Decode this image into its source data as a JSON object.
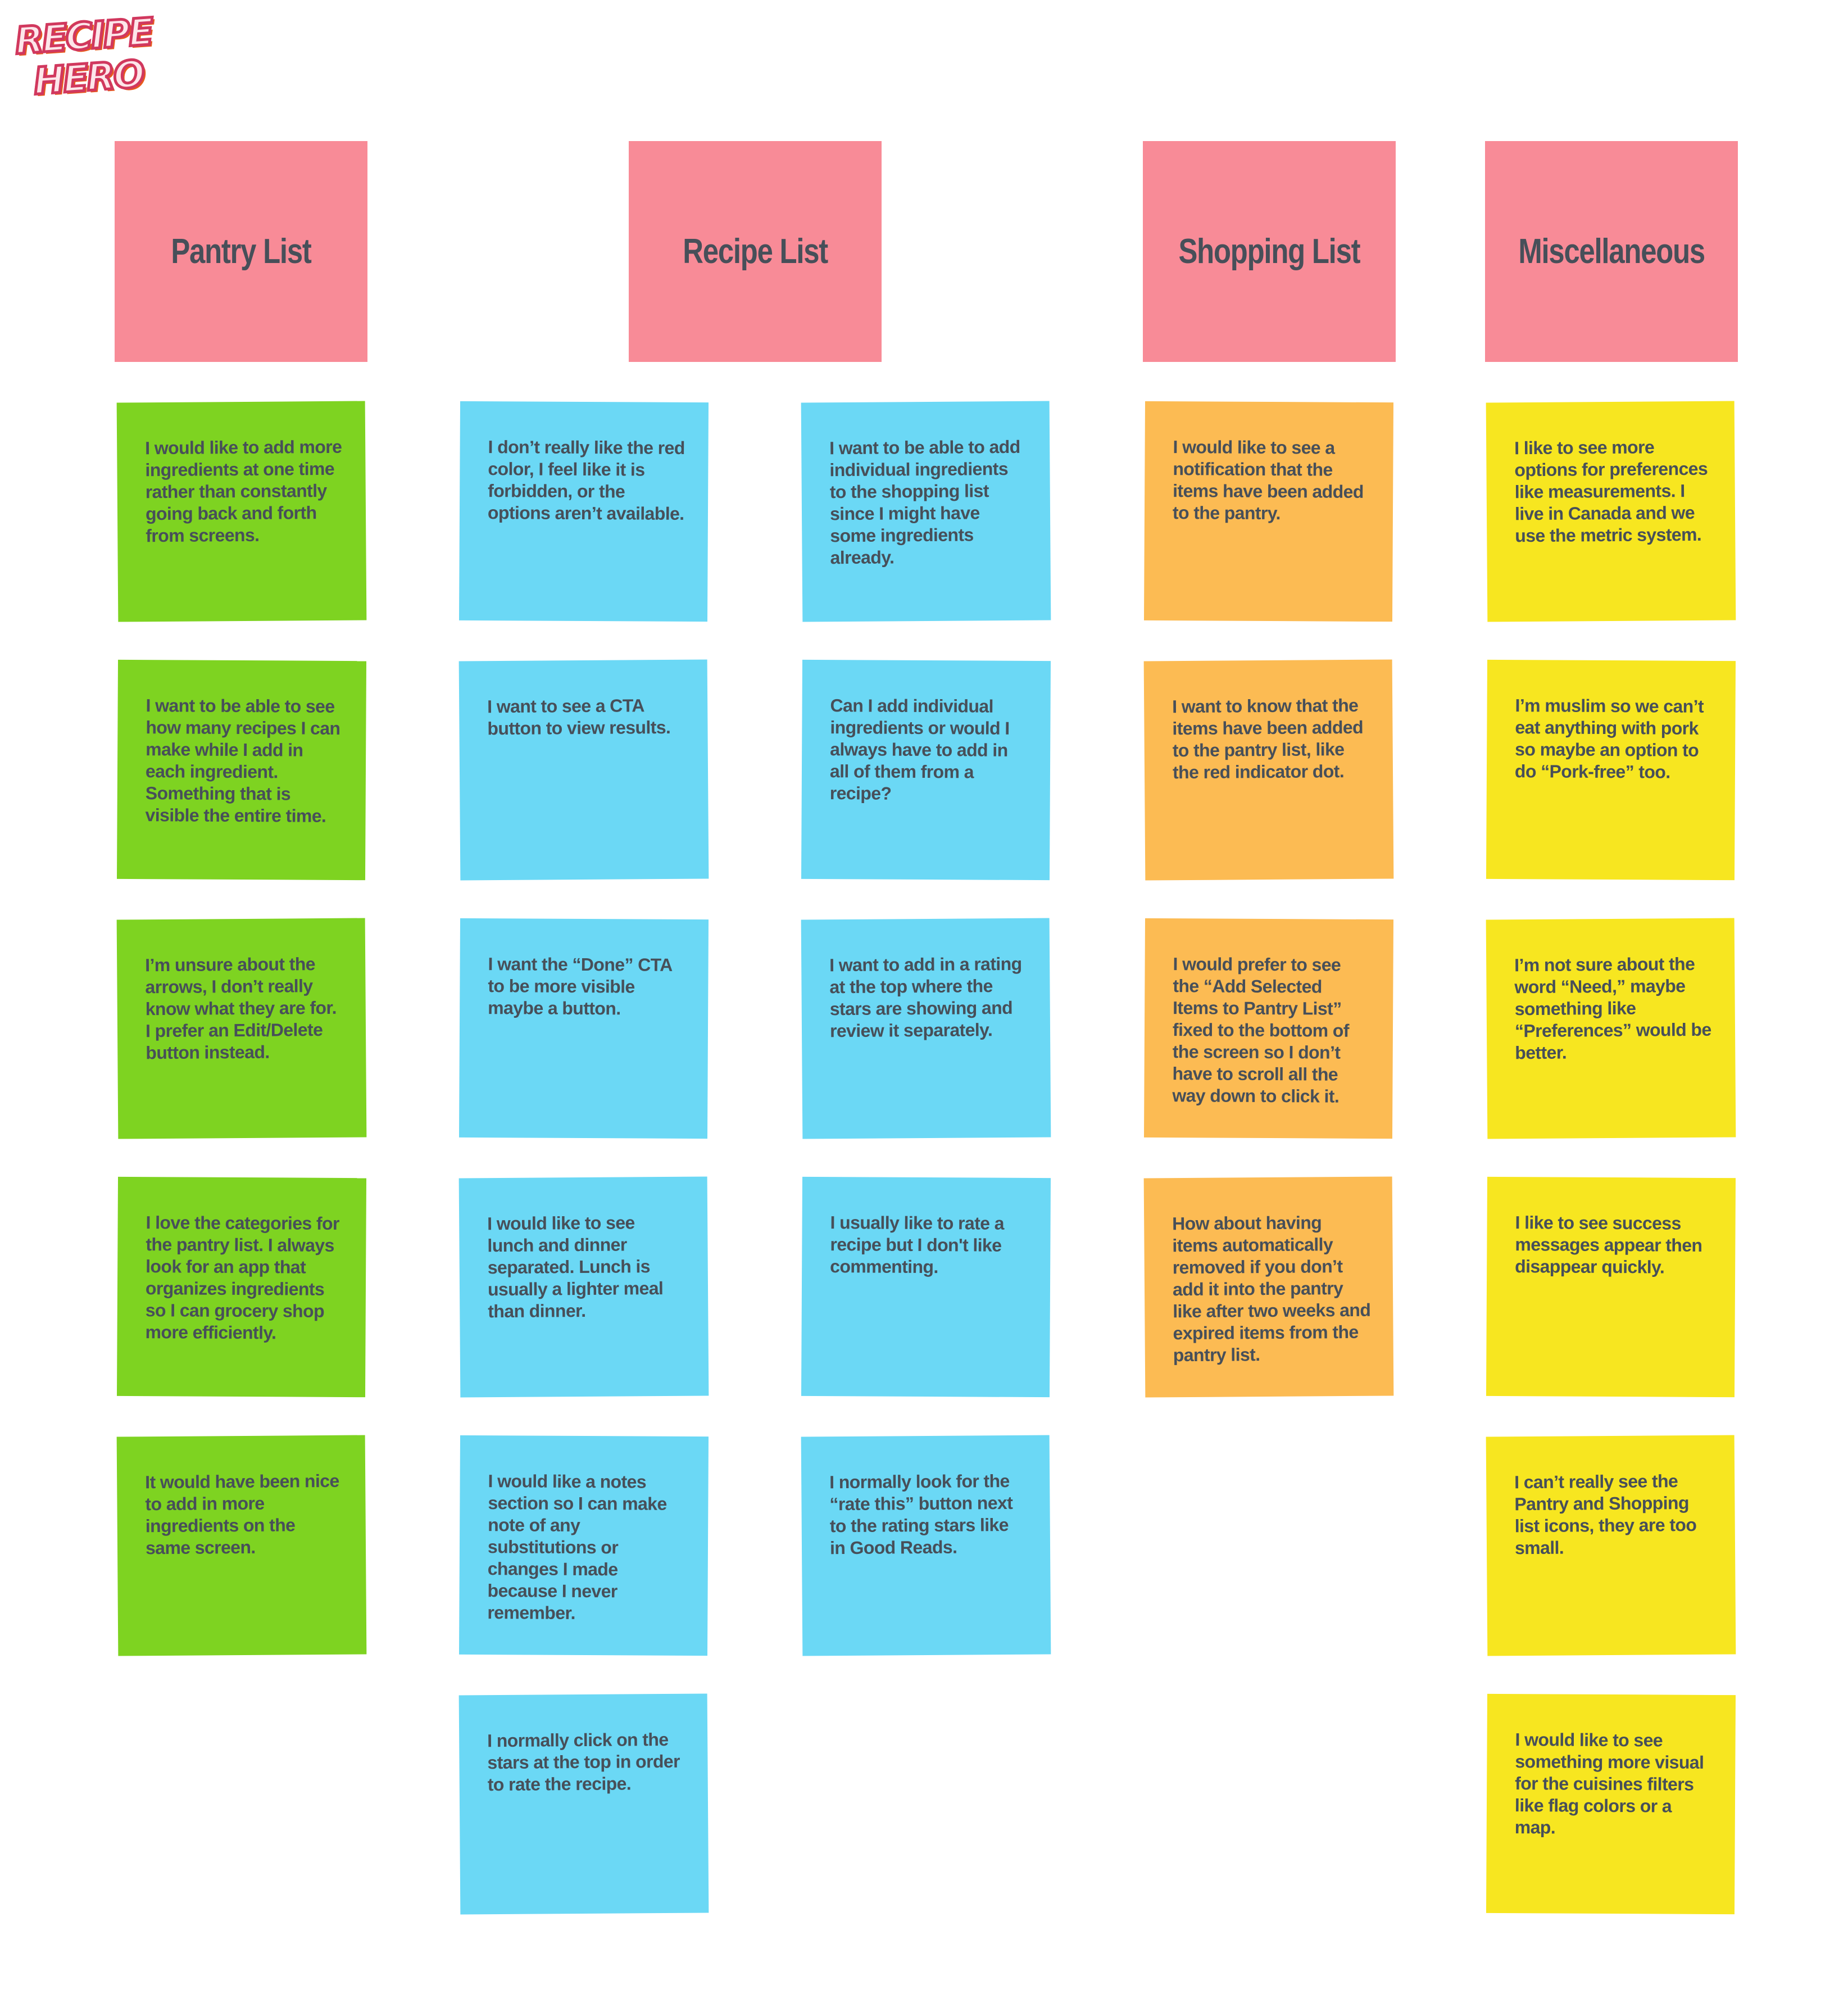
{
  "logo": {
    "line1": "RECIPE",
    "line2": "HERO"
  },
  "colors": {
    "header": "#f88b97",
    "pantry": "#7ed321",
    "recipe": "#6bd8f5",
    "shopping": "#fcbb53",
    "misc": "#f7e620",
    "text": "#474f59"
  },
  "headers": [
    {
      "title": "Pantry List"
    },
    {
      "title": "Recipe List"
    },
    {
      "title": "Shopping List"
    },
    {
      "title": "Miscellaneous"
    }
  ],
  "columns": {
    "pantry": [
      "I would like to add more ingredients at one time rather than constantly going back and forth from screens.",
      "I want to be able to see how many recipes I can make while I add in each ingredient. Something that is visible the entire time.",
      "I’m unsure about the arrows, I don’t really know what they are for. I prefer an Edit/Delete button instead.",
      "I love the categories for the pantry list. I always look for an app that organizes ingredients so I can grocery shop more efficiently.",
      "It would have been nice to add in more ingredients on the same screen."
    ],
    "recipe_a": [
      "I don’t really like the red color, I feel like it is forbidden, or the options aren’t available.",
      "I want to see a CTA button to view results.",
      "I want the “Done” CTA to be more visible maybe a button.",
      "I would like to see lunch and dinner separated. Lunch is usually a lighter meal than dinner.",
      "I would like a notes section so I can make note of any substitutions or changes I made because I never remember.",
      "I normally click on the stars at the top in order to rate the recipe."
    ],
    "recipe_b": [
      "I want to be able to add individual ingredients to the shopping list since I might have some ingredients already.",
      "Can I add individual ingredients or would I always have to add in all of them from a recipe?",
      "I want to add in a rating at the top where the stars are showing and review it separately.",
      "I usually like to rate a recipe but I don't like commenting.",
      "I normally look for the “rate this” button next to the rating stars like in Good Reads."
    ],
    "shopping": [
      "I would like to see a notification that the items have been added to the pantry.",
      "I want to know that the items have been added to the pantry list, like the red indicator dot.",
      "I would prefer to see the “Add Selected Items to Pantry List” fixed to the bottom of the screen so I don’t have to scroll all the way down to click it.",
      "How about having items automatically removed if you don’t add it into the pantry like after two weeks and expired items from the pantry list."
    ],
    "misc": [
      "I like to see more options for preferences like measurements. I live in Canada and we use the metric system.",
      "I’m muslim so we can’t eat anything with pork so maybe an option to do “Pork-free” too.",
      "I’m not sure about the word “Need,” maybe something like “Preferences” would be better.",
      "I like to see success messages appear then disappear quickly.",
      "I can’t really see the Pantry and Shopping list icons, they are too small.",
      "I would like to see something more visual for the cuisines filters like flag colors or a map."
    ]
  }
}
